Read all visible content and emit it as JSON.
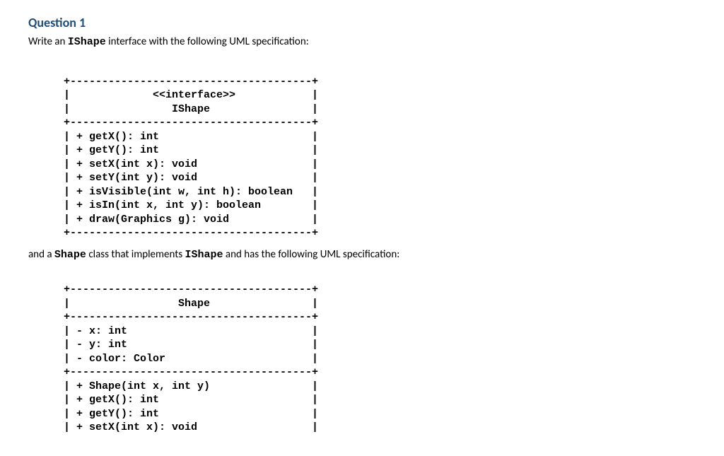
{
  "question": {
    "title": "Question 1",
    "prompt_before": "Write an ",
    "prompt_code": "IShape",
    "prompt_after": " interface with the following UML specification:"
  },
  "uml_interface": {
    "border_top": "+--------------------------------------+",
    "header1": "|             <<interface>>            |",
    "header2": "|                IShape                |",
    "border_mid": "+--------------------------------------+",
    "line1": "| + getX(): int                        |",
    "line2": "| + getY(): int                        |",
    "line3": "| + setX(int x): void                  |",
    "line4": "| + setY(int y): void                  |",
    "line5": "| + isVisible(int w, int h): boolean   |",
    "line6": "| + isIn(int x, int y): boolean        |",
    "line7": "| + draw(Graphics g): void             |",
    "border_bot": "+--------------------------------------+"
  },
  "mid": {
    "before1": "and a ",
    "code1": "Shape",
    "between": " class that implements ",
    "code2": "IShape",
    "after": " and has the following UML specification:"
  },
  "uml_shape": {
    "border_top": "+--------------------------------------+",
    "header1": "|                 Shape                |",
    "border_mid1": "+--------------------------------------+",
    "line1": "| - x: int                             |",
    "line2": "| - y: int                             |",
    "line3": "| - color: Color                       |",
    "border_mid2": "+--------------------------------------+",
    "line4": "| + Shape(int x, int y)                |",
    "line5": "| + getX(): int                        |",
    "line6": "| + getY(): int                        |",
    "line7": "| + setX(int x): void                  |"
  }
}
